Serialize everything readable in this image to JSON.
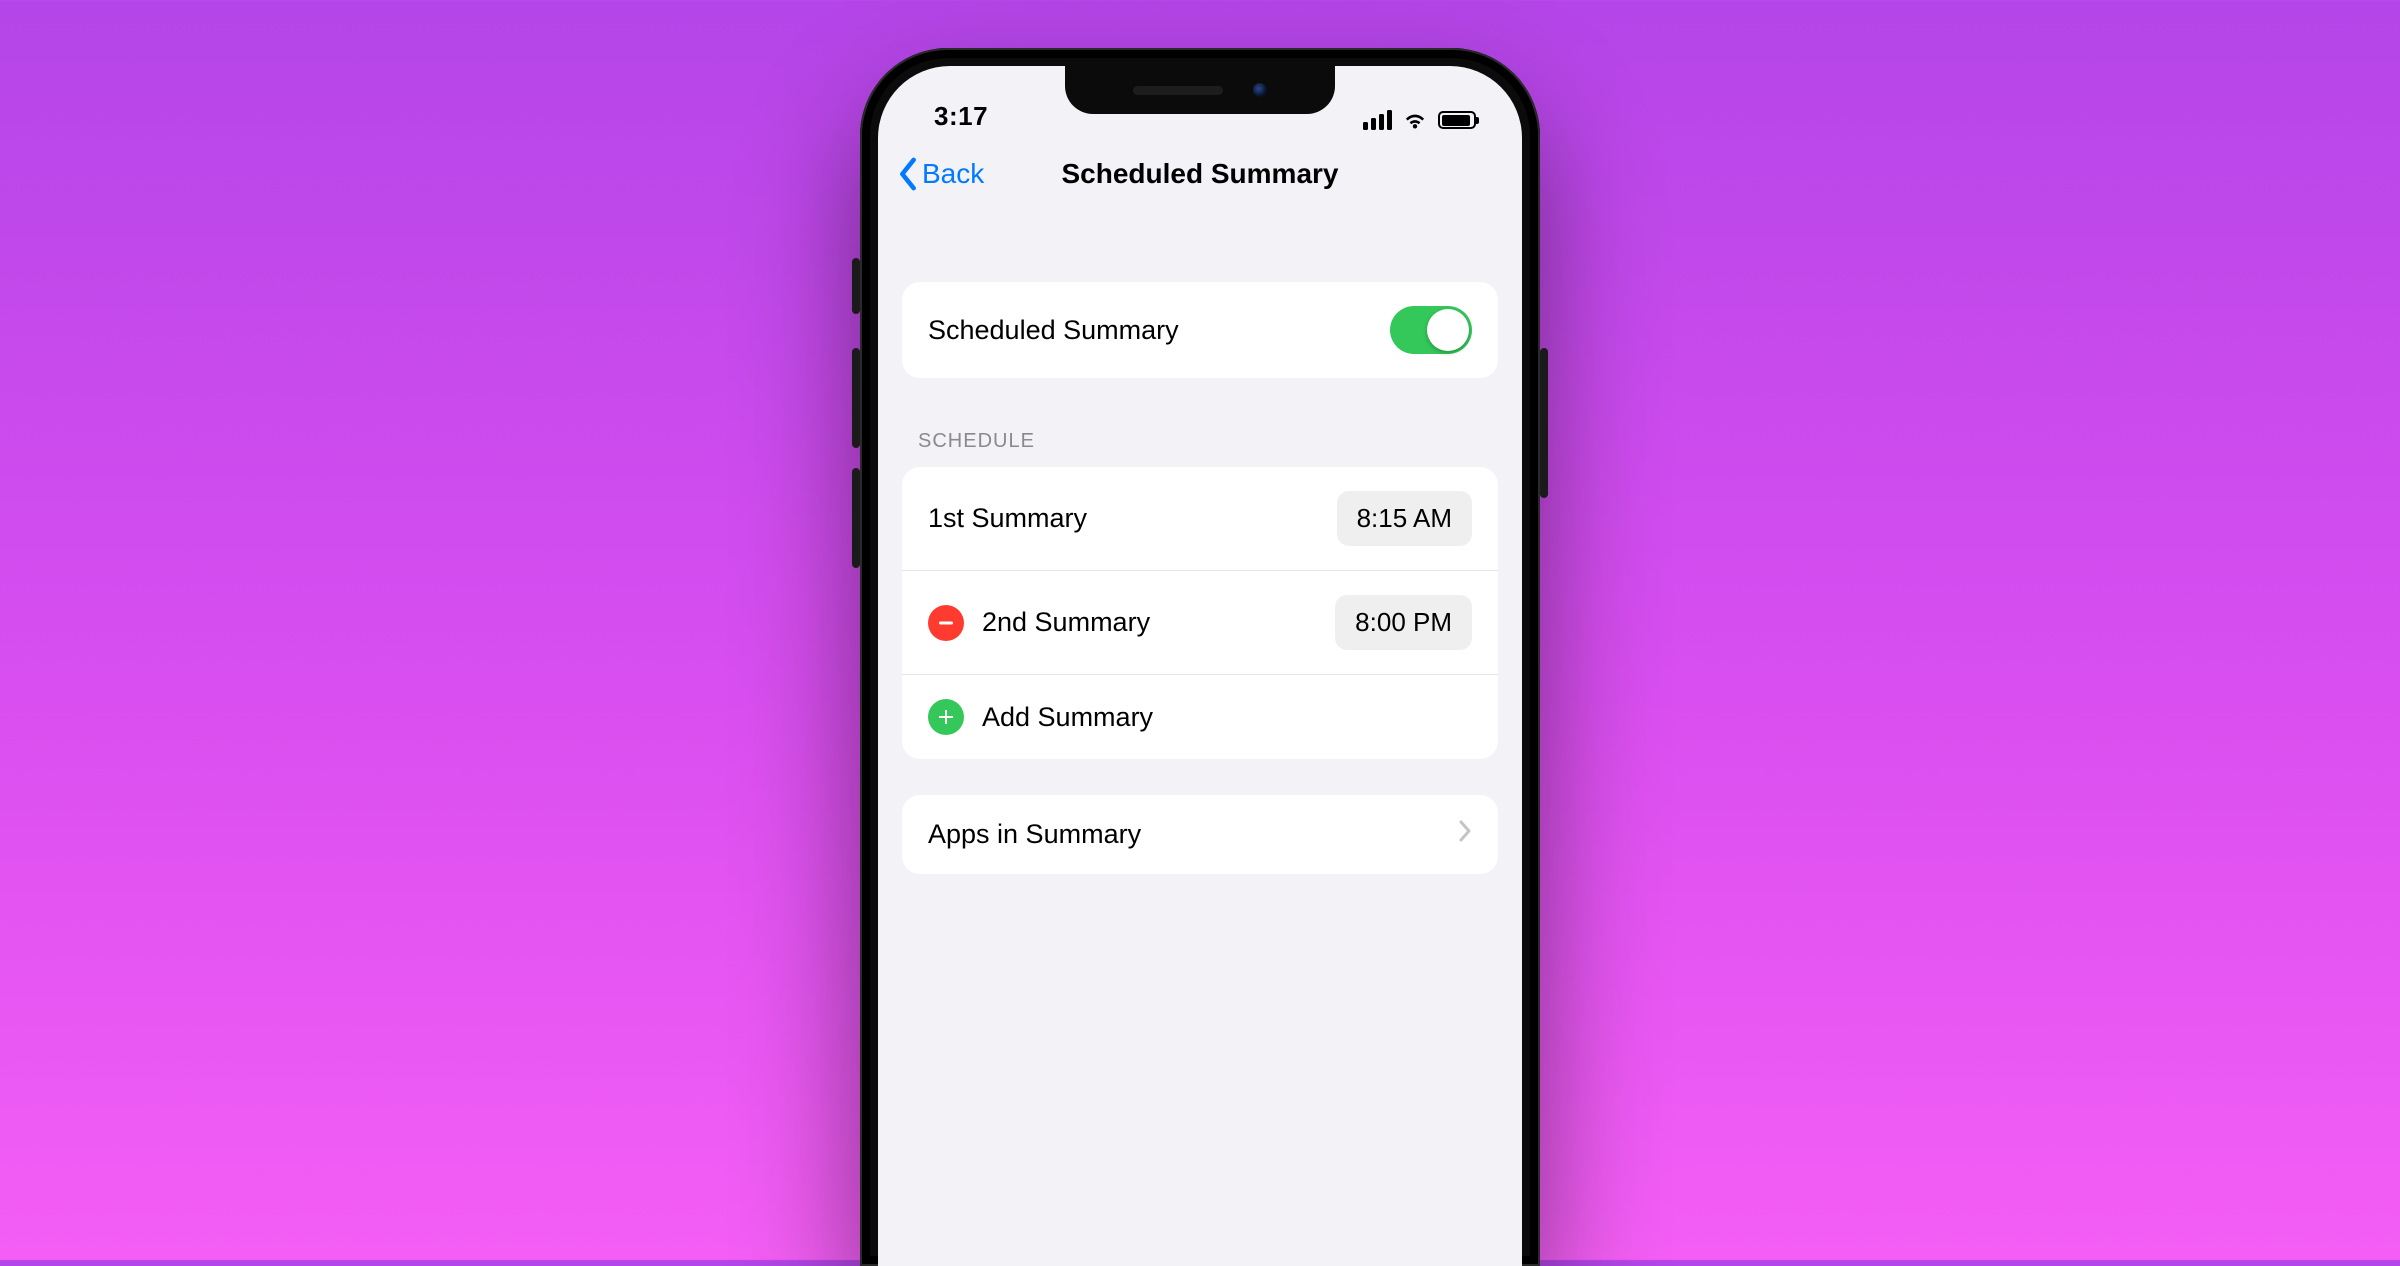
{
  "statusbar": {
    "time": "3:17"
  },
  "navbar": {
    "back_label": "Back",
    "title": "Scheduled Summary"
  },
  "toggle_row": {
    "label": "Scheduled Summary",
    "enabled": true
  },
  "schedule": {
    "header": "SCHEDULE",
    "items": [
      {
        "label": "1st Summary",
        "time": "8:15 AM"
      },
      {
        "label": "2nd Summary",
        "time": "8:00 PM"
      }
    ],
    "add_label": "Add Summary"
  },
  "apps_row": {
    "label": "Apps in Summary"
  }
}
